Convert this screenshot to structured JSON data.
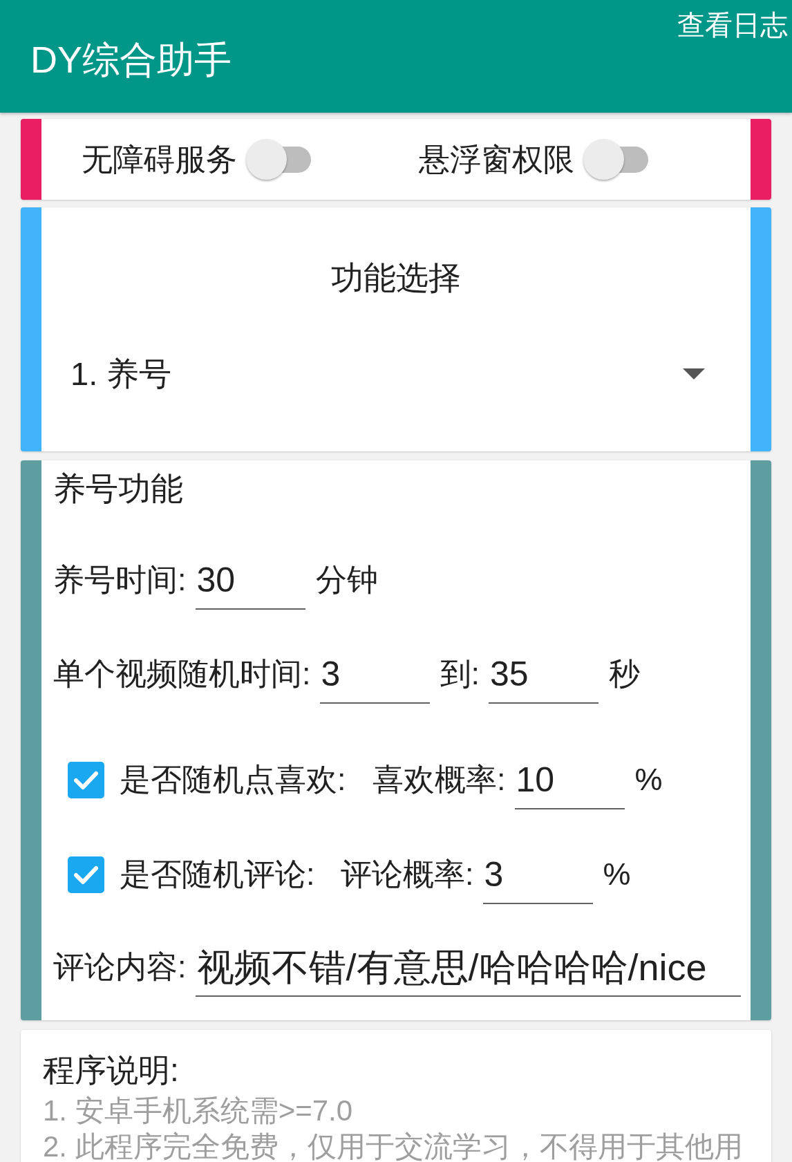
{
  "app_bar": {
    "title": "DY综合助手",
    "action": "查看日志"
  },
  "permissions": [
    {
      "label": "无障碍服务",
      "on": false
    },
    {
      "label": "悬浮窗权限",
      "on": false
    }
  ],
  "function_select": {
    "title": "功能选择",
    "value": "1. 养号"
  },
  "nurture": {
    "title": "养号功能",
    "duration": {
      "label": "养号时间:",
      "value": "30",
      "unit": "分钟"
    },
    "video_time": {
      "label": "单个视频随机时间:",
      "min": "3",
      "separator": "到:",
      "max": "35",
      "unit": "秒"
    },
    "options": [
      {
        "label": "是否随机点喜欢:",
        "checked": true,
        "rate_label": "喜欢概率:",
        "rate": "10",
        "unit": "%"
      },
      {
        "label": "是否随机评论:",
        "checked": true,
        "rate_label": "评论概率:",
        "rate": "3",
        "unit": "%"
      }
    ],
    "comment": {
      "label": "评论内容:",
      "value": "视频不错/有意思/哈哈哈哈/nice"
    }
  },
  "notes": {
    "title": "程序说明:",
    "lines": [
      "1. 安卓手机系统需>=7.0",
      "2. 此程序完全免费，仅用于交流学习，不得用于其他用"
    ]
  }
}
